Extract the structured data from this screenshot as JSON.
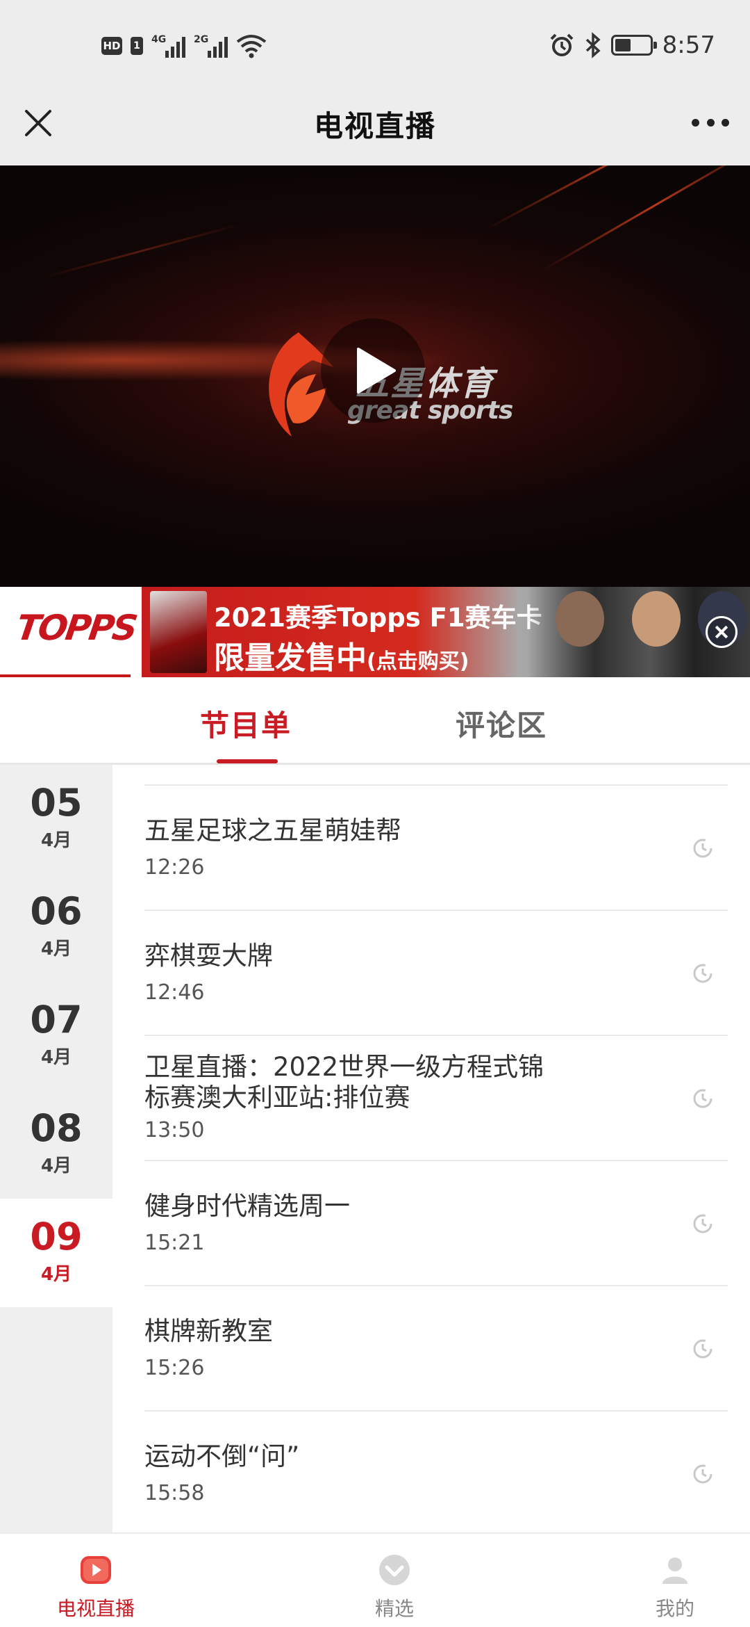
{
  "status_bar": {
    "hd": "HD",
    "sim": "1",
    "network1": "4G",
    "network2": "2G",
    "time": "8:57",
    "icons": [
      "alarm-icon",
      "bluetooth-icon",
      "battery-icon",
      "wifi-icon"
    ],
    "battery_level": 0.45
  },
  "nav": {
    "title": "电视直播",
    "close_icon": "close-icon",
    "more_icon": "more-icon"
  },
  "video": {
    "channel_logo_cn": "五星体育",
    "channel_logo_en": "great sports",
    "play_icon": "play-icon"
  },
  "ad": {
    "brand": "TOPPS",
    "line1": "2021赛季Topps F1赛车卡",
    "line2": "限量发售中",
    "line2_suffix": "(点击购买)",
    "close_icon": "close-circle-icon"
  },
  "tabs": [
    {
      "label": "节目单",
      "active": true
    },
    {
      "label": "评论区",
      "active": false
    }
  ],
  "dates": [
    {
      "day": "05",
      "month": "4月",
      "active": false
    },
    {
      "day": "06",
      "month": "4月",
      "active": false
    },
    {
      "day": "07",
      "month": "4月",
      "active": false
    },
    {
      "day": "08",
      "month": "4月",
      "active": false
    },
    {
      "day": "09",
      "month": "4月",
      "active": true
    }
  ],
  "programs": [
    {
      "title": "五星足球之五星萌娃帮",
      "time": "12:26",
      "icon": "reminder-clock-icon"
    },
    {
      "title": "弈棋耍大牌",
      "time": "12:46",
      "icon": "reminder-clock-icon"
    },
    {
      "title": "卫星直播：2022世界一级方程式锦",
      "title2": "标赛澳大利亚站:排位赛",
      "time": "13:50",
      "icon": "reminder-clock-icon"
    },
    {
      "title": "健身时代精选周一",
      "time": "15:21",
      "icon": "reminder-clock-icon"
    },
    {
      "title": "棋牌新教室",
      "time": "15:26",
      "icon": "reminder-clock-icon"
    },
    {
      "title": "运动不倒“问”",
      "time": "15:58",
      "icon": "reminder-clock-icon"
    }
  ],
  "bottom_nav": [
    {
      "label": "电视直播",
      "icon": "tv-live-icon",
      "active": true
    },
    {
      "label": "精选",
      "icon": "picks-icon",
      "active": false
    },
    {
      "label": "我的",
      "icon": "profile-icon",
      "active": false
    }
  ],
  "colors": {
    "accent": "#c91b23",
    "bar_bg": "#ededed",
    "rail_bg": "#efefef"
  }
}
